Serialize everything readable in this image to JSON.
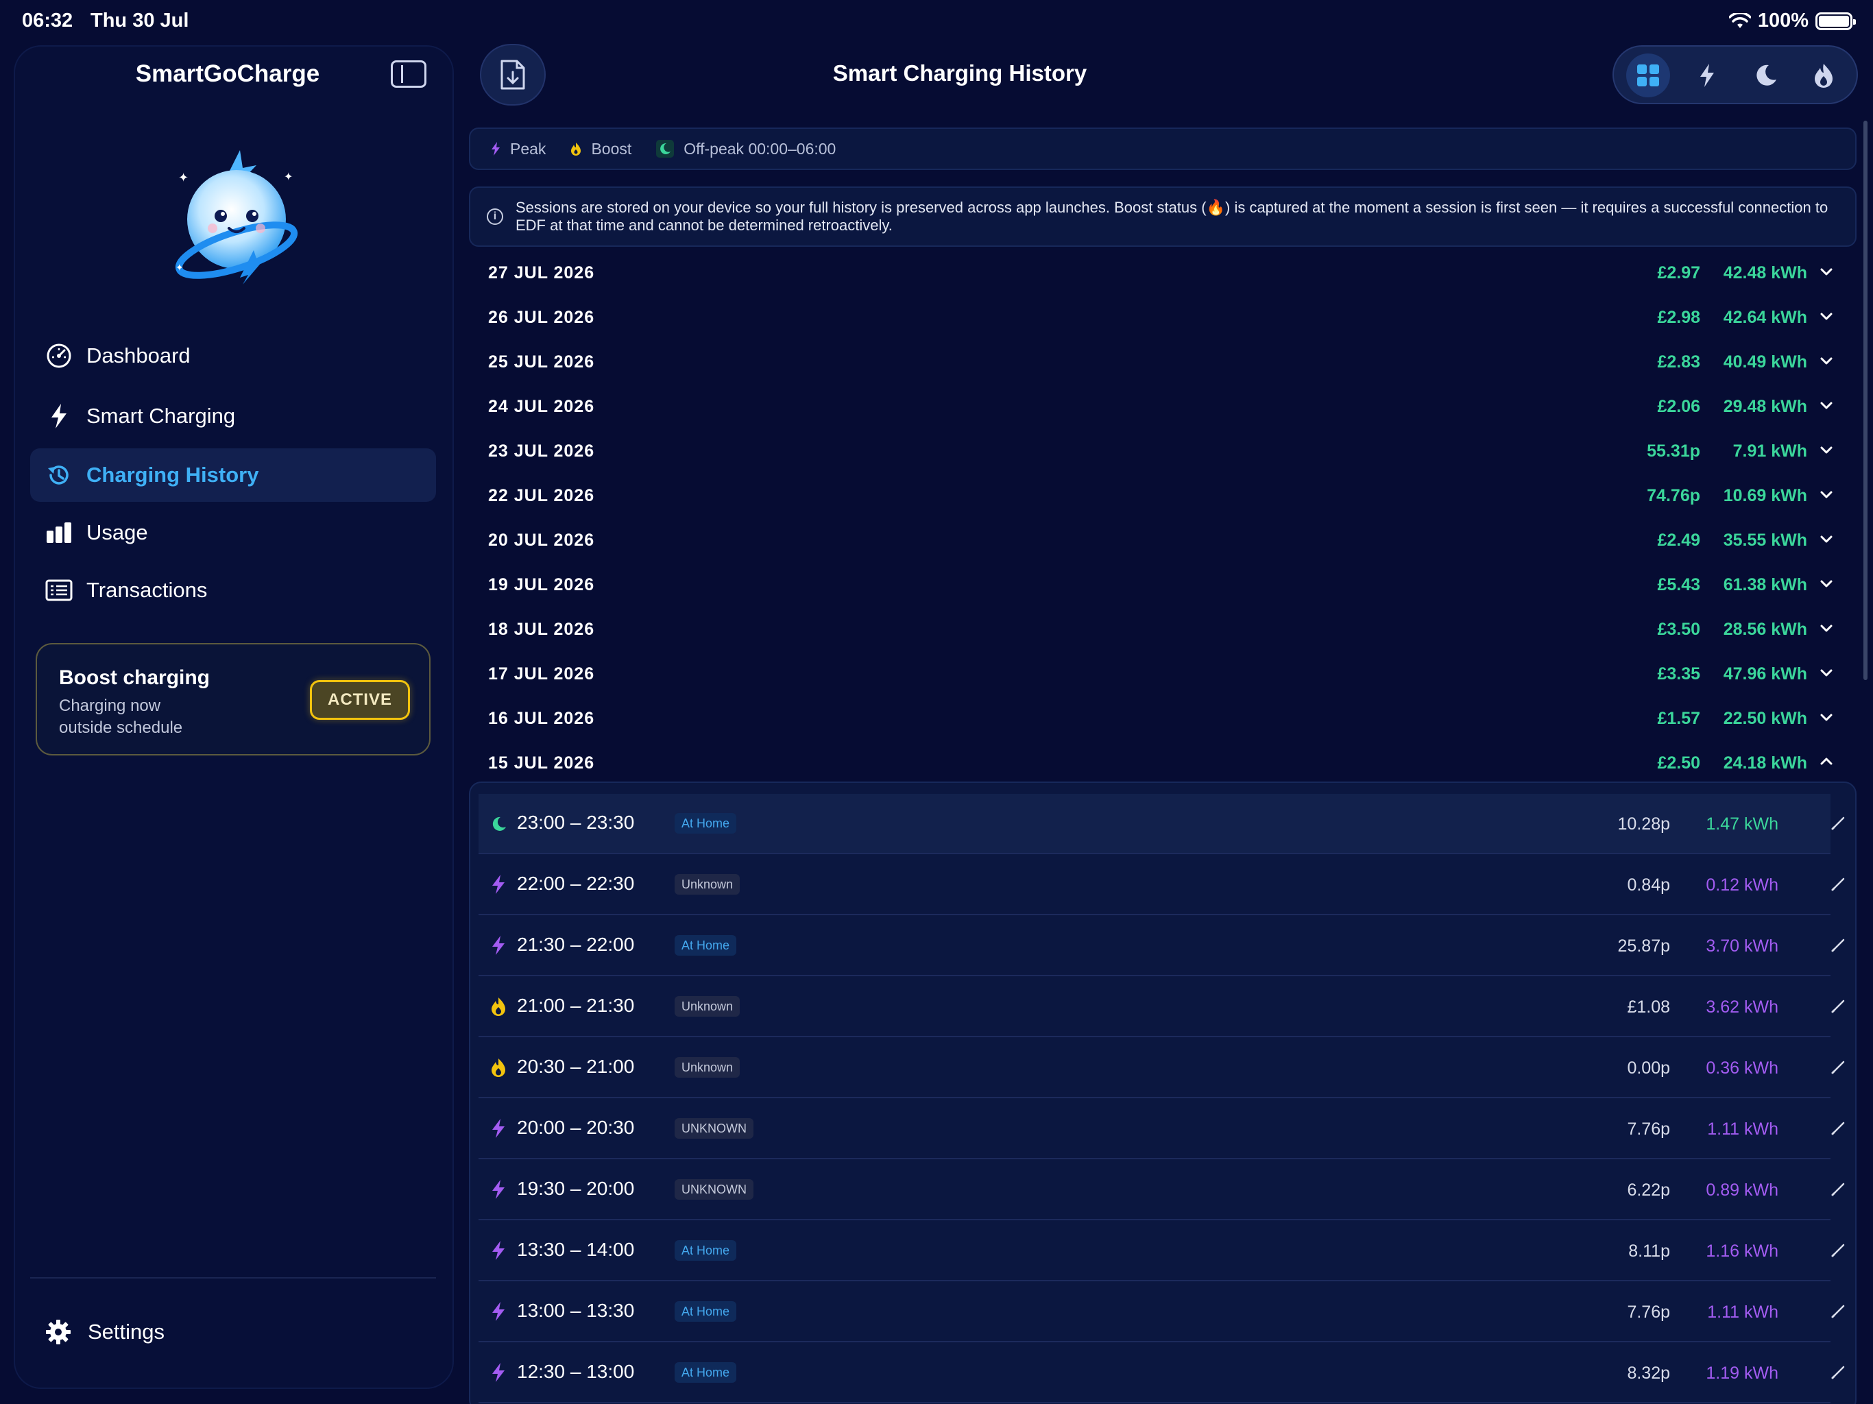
{
  "status_bar": {
    "time": "06:32",
    "date": "Thu 30 Jul",
    "battery": "100%"
  },
  "sidebar": {
    "app_title": "SmartGoCharge",
    "items": [
      {
        "label": "Dashboard",
        "icon": "gauge-icon"
      },
      {
        "label": "Smart Charging",
        "icon": "bolt-icon"
      },
      {
        "label": "Charging History",
        "icon": "history-icon",
        "active": true
      },
      {
        "label": "Usage",
        "icon": "bar-chart-icon"
      },
      {
        "label": "Transactions",
        "icon": "receipt-icon"
      }
    ],
    "boost": {
      "title": "Boost charging",
      "subtitle": "Charging now outside schedule",
      "badge": "ACTIVE"
    },
    "settings_label": "Settings"
  },
  "header": {
    "title": "Smart Charging History",
    "active_filter": "all"
  },
  "legend": {
    "peak": "Peak",
    "boost": "Boost",
    "offpeak": "Off-peak 00:00–06:00"
  },
  "info_text": "Sessions are stored on your device so your full history is preserved across app launches. Boost status (🔥) is captured at the moment a session is first seen — it requires a successful connection to EDF at that time and cannot be determined retroactively.",
  "days": [
    {
      "date": "27 JUL 2026",
      "cost": "£2.97",
      "kwh": "42.48 kWh",
      "expanded": false
    },
    {
      "date": "26 JUL 2026",
      "cost": "£2.98",
      "kwh": "42.64 kWh",
      "expanded": false
    },
    {
      "date": "25 JUL 2026",
      "cost": "£2.83",
      "kwh": "40.49 kWh",
      "expanded": false
    },
    {
      "date": "24 JUL 2026",
      "cost": "£2.06",
      "kwh": "29.48 kWh",
      "expanded": false
    },
    {
      "date": "23 JUL 2026",
      "cost": "55.31p",
      "kwh": "7.91 kWh",
      "expanded": false
    },
    {
      "date": "22 JUL 2026",
      "cost": "74.76p",
      "kwh": "10.69 kWh",
      "expanded": false
    },
    {
      "date": "20 JUL 2026",
      "cost": "£2.49",
      "kwh": "35.55 kWh",
      "expanded": false
    },
    {
      "date": "19 JUL 2026",
      "cost": "£5.43",
      "kwh": "61.38 kWh",
      "expanded": false
    },
    {
      "date": "18 JUL 2026",
      "cost": "£3.50",
      "kwh": "28.56 kWh",
      "expanded": false
    },
    {
      "date": "17 JUL 2026",
      "cost": "£3.35",
      "kwh": "47.96 kWh",
      "expanded": false
    },
    {
      "date": "16 JUL 2026",
      "cost": "£1.57",
      "kwh": "22.50 kWh",
      "expanded": false
    },
    {
      "date": "15 JUL 2026",
      "cost": "£2.50",
      "kwh": "24.18 kWh",
      "expanded": true
    }
  ],
  "sessions": [
    {
      "time": "23:00 – 23:30",
      "tag": "At Home",
      "tag_type": "home",
      "cost": "10.28p",
      "kwh": "1.47 kWh",
      "kind": "offpeak"
    },
    {
      "time": "22:00 – 22:30",
      "tag": "Unknown",
      "tag_type": "unknown",
      "cost": "0.84p",
      "kwh": "0.12 kWh",
      "kind": "peak"
    },
    {
      "time": "21:30 – 22:00",
      "tag": "At Home",
      "tag_type": "home",
      "cost": "25.87p",
      "kwh": "3.70 kWh",
      "kind": "peak"
    },
    {
      "time": "21:00 – 21:30",
      "tag": "Unknown",
      "tag_type": "unknown",
      "cost": "£1.08",
      "kwh": "3.62 kWh",
      "kind": "boost"
    },
    {
      "time": "20:30 – 21:00",
      "tag": "Unknown",
      "tag_type": "unknown",
      "cost": "0.00p",
      "kwh": "0.36 kWh",
      "kind": "boost"
    },
    {
      "time": "20:00 – 20:30",
      "tag": "UNKNOWN",
      "tag_type": "unknown",
      "cost": "7.76p",
      "kwh": "1.11 kWh",
      "kind": "peak"
    },
    {
      "time": "19:30 – 20:00",
      "tag": "UNKNOWN",
      "tag_type": "unknown",
      "cost": "6.22p",
      "kwh": "0.89 kWh",
      "kind": "peak"
    },
    {
      "time": "13:30 – 14:00",
      "tag": "At Home",
      "tag_type": "home",
      "cost": "8.11p",
      "kwh": "1.16 kWh",
      "kind": "peak"
    },
    {
      "time": "13:00 – 13:30",
      "tag": "At Home",
      "tag_type": "home",
      "cost": "7.76p",
      "kwh": "1.11 kWh",
      "kind": "peak"
    },
    {
      "time": "12:30 – 13:00",
      "tag": "At Home",
      "tag_type": "home",
      "cost": "8.32p",
      "kwh": "1.19 kWh",
      "kind": "peak"
    }
  ],
  "colors": {
    "background": "#060c33",
    "accent_blue": "#3fb0f5",
    "kwh_green": "#3bd69b",
    "kwh_purple": "#a35cf2",
    "boost_yellow": "#f2c30e"
  }
}
